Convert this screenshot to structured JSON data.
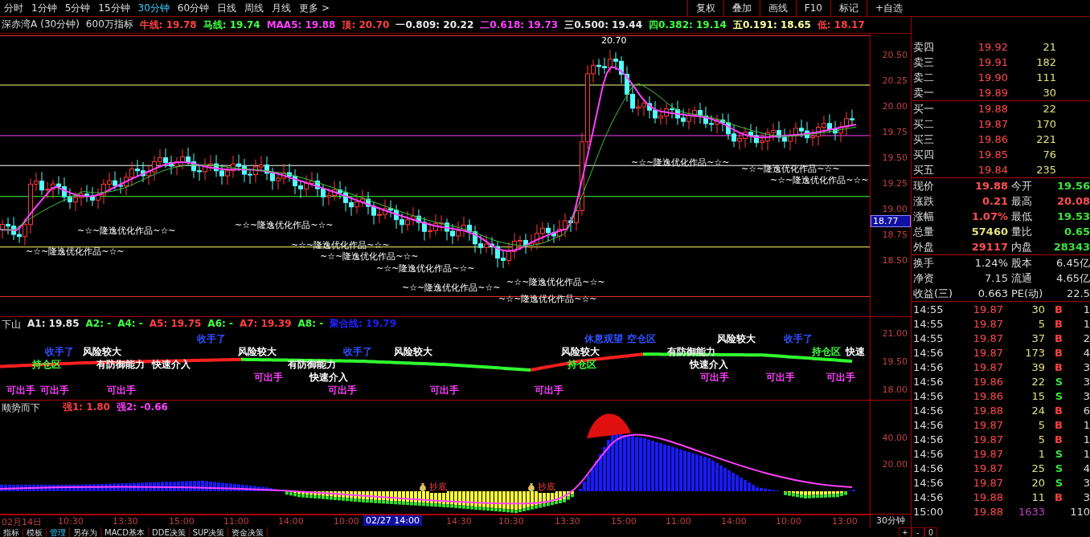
{
  "period_tabs": [
    {
      "label": "分时",
      "selected": false
    },
    {
      "label": "1分钟",
      "selected": false
    },
    {
      "label": "5分钟",
      "selected": false
    },
    {
      "label": "15分钟",
      "selected": false
    },
    {
      "label": "30分钟",
      "selected": true
    },
    {
      "label": "60分钟",
      "selected": false
    },
    {
      "label": "日线",
      "selected": false
    },
    {
      "label": "周线",
      "selected": false
    },
    {
      "label": "月线",
      "selected": false
    },
    {
      "label": "更多 >",
      "selected": false
    }
  ],
  "toolbar_buttons": [
    "复权",
    "叠加",
    "画线",
    "F10",
    "标记",
    "+自选"
  ],
  "info_bar": {
    "stock": "深赤湾A",
    "period": "(30分钟)",
    "indicator": "600万指标",
    "items": [
      {
        "text": "牛线: 19.78",
        "color": "#ff4040"
      },
      {
        "text": "马线: 19.74",
        "color": "#40ff40"
      },
      {
        "text": "MAA5: 19.88",
        "color": "#ff40ff"
      },
      {
        "text": "顶: 20.70",
        "color": "#ff4040"
      },
      {
        "text": "一0.809: 20.22",
        "color": "#e8e8e8"
      },
      {
        "text": "二0.618: 19.73",
        "color": "#ff40ff"
      },
      {
        "text": "三0.500: 19.44",
        "color": "#e8e8e8"
      },
      {
        "text": "四0.382: 19.14",
        "color": "#40ff40"
      },
      {
        "text": "五0.191: 18.65",
        "color": "#ffffa0"
      },
      {
        "text": "低: 18.17",
        "color": "#ff4040"
      }
    ]
  },
  "main_chart": {
    "top_label": "20.70",
    "current_price_tag": "18.77",
    "price_axis": [
      "20.50",
      "20.25",
      "20.00",
      "19.75",
      "19.50",
      "19.25",
      "19.00",
      "18.75",
      "18.50"
    ],
    "annotations": [
      "~☆~隆逸优化作品~☆~",
      "~☆~隆逸优化作品~☆~",
      "~☆~隆逸优化作品~☆~",
      "~☆~隆逸优化作品~☆~",
      "~☆~隆逸优化作品~☆~",
      "~☆~隆逸优化作品~☆~",
      "~☆~隆逸优化作品~☆~",
      "~☆~隆逸优化作品~☆~",
      "~☆~隆逸优化作品~☆~",
      "~☆~隆逸优化作品~☆~",
      "~☆~隆逸优化作品~☆~",
      "~☆~隆逸优化作品~☆~"
    ]
  },
  "indicator_panel": {
    "title": "下山",
    "values": [
      {
        "text": "A1: 19.85",
        "color": "#e8e8e8"
      },
      {
        "text": "A2: -",
        "color": "#40ff40"
      },
      {
        "text": "A4: -",
        "color": "#40ff40"
      },
      {
        "text": "A5: 19.75",
        "color": "#ff4040"
      },
      {
        "text": "A6: -",
        "color": "#40ff40"
      },
      {
        "text": "A7: 19.39",
        "color": "#ff4040"
      },
      {
        "text": "A8: -",
        "color": "#40ff40"
      },
      {
        "text": "聚合线: 19.79",
        "color": "#2020ff"
      }
    ],
    "axis": [
      "21.00",
      "19.50",
      "18.00"
    ],
    "signals": [
      {
        "text": "可出手",
        "color": "#ff40ff"
      },
      {
        "text": "持仓区",
        "color": "#40ff40"
      },
      {
        "text": "可出手",
        "color": "#ff40ff"
      },
      {
        "text": "收手了",
        "color": "#3050ff"
      },
      {
        "text": "风险较大",
        "color": "#ffffff"
      },
      {
        "text": "有防御能力",
        "color": "#ffffff"
      },
      {
        "text": "可出手",
        "color": "#ff40ff"
      },
      {
        "text": "快速介入",
        "color": "#ffffff"
      },
      {
        "text": "收手了",
        "color": "#3050ff"
      },
      {
        "text": "风险较大",
        "color": "#ffffff"
      },
      {
        "text": "可出手",
        "color": "#ff40ff"
      },
      {
        "text": "有防御能力",
        "color": "#ffffff"
      },
      {
        "text": "快速介入",
        "color": "#ffffff"
      },
      {
        "text": "可出手",
        "color": "#ff40ff"
      },
      {
        "text": "收手了",
        "color": "#3050ff"
      },
      {
        "text": "风险较大",
        "color": "#ffffff"
      },
      {
        "text": "可出手",
        "color": "#ff40ff"
      },
      {
        "text": "可出手",
        "color": "#ff40ff"
      },
      {
        "text": "风险较大",
        "color": "#ffffff"
      },
      {
        "text": "持仓区",
        "color": "#40ff40"
      },
      {
        "text": "休息观望",
        "color": "#3050ff"
      },
      {
        "text": "空仓区",
        "color": "#3050ff"
      },
      {
        "text": "有防御能力",
        "color": "#ffffff"
      },
      {
        "text": "快速介入",
        "color": "#ffffff"
      },
      {
        "text": "可出手",
        "color": "#ff40ff"
      },
      {
        "text": "风险较大",
        "color": "#ffffff"
      },
      {
        "text": "可出手",
        "color": "#ff40ff"
      },
      {
        "text": "收手了",
        "color": "#3050ff"
      },
      {
        "text": "持仓区",
        "color": "#40ff40"
      },
      {
        "text": "可出手",
        "color": "#ff40ff"
      },
      {
        "text": "快速",
        "color": "#ffffff"
      }
    ]
  },
  "trend_panel": {
    "title": "顺势而下",
    "values": [
      {
        "text": "强1: 1.80",
        "color": "#ff4040"
      },
      {
        "text": "强2: -0.66",
        "color": "#ff40ff"
      }
    ],
    "axis": [
      "40.00",
      "20.00"
    ],
    "signals": [
      "抄底",
      "抄底"
    ]
  },
  "time_axis": {
    "ticks": [
      "02月14日",
      "10:30",
      "13:30",
      "15:00",
      "11:00",
      "14:00",
      "10:00",
      "14:30",
      "10:30",
      "13:30",
      "15:00",
      "11:00",
      "14:00",
      "10:00",
      "13:00"
    ],
    "cursor": "02/27 14:00",
    "period": "30分钟",
    "zoom_buttons": [
      "+",
      "-",
      "0"
    ]
  },
  "bottom_tabs": [
    {
      "label": "指标",
      "selected": false
    },
    {
      "label": "模板",
      "selected": false
    },
    {
      "label": "管理",
      "selected": true
    },
    {
      "label": "另存为",
      "selected": false
    },
    {
      "label": "MACD基本",
      "selected": false
    },
    {
      "label": "DDE决策",
      "selected": false
    },
    {
      "label": "SUP决策",
      "selected": false
    },
    {
      "label": "资金决策",
      "selected": false
    }
  ],
  "order_book": {
    "asks": [
      {
        "label": "卖四",
        "price": "19.92",
        "volume": "21"
      },
      {
        "label": "卖三",
        "price": "19.91",
        "volume": "182"
      },
      {
        "label": "卖二",
        "price": "19.90",
        "volume": "111"
      },
      {
        "label": "卖一",
        "price": "19.89",
        "volume": "30"
      }
    ],
    "bids": [
      {
        "label": "买一",
        "price": "19.88",
        "volume": "22"
      },
      {
        "label": "买二",
        "price": "19.87",
        "volume": "170"
      },
      {
        "label": "买三",
        "price": "19.86",
        "volume": "221"
      },
      {
        "label": "买四",
        "price": "19.85",
        "volume": "76"
      },
      {
        "label": "买五",
        "price": "19.84",
        "volume": "235"
      }
    ]
  },
  "quote_stats": [
    {
      "label": "现价",
      "value": "19.88",
      "color": "#ff5050"
    },
    {
      "label": "今开",
      "value": "19.56",
      "color": "#40e040"
    },
    {
      "label": "涨跌",
      "value": "0.21",
      "color": "#ff5050"
    },
    {
      "label": "最高",
      "value": "20.08",
      "color": "#ff5050"
    },
    {
      "label": "涨幅",
      "value": "1.07%",
      "color": "#ff5050"
    },
    {
      "label": "最低",
      "value": "19.53",
      "color": "#40e040"
    },
    {
      "label": "总量",
      "value": "57460",
      "color": "#e0e080"
    },
    {
      "label": "量比",
      "value": "0.65",
      "color": "#40e040"
    },
    {
      "label": "外盘",
      "value": "29117",
      "color": "#ff5050"
    },
    {
      "label": "内盘",
      "value": "28343",
      "color": "#40e040"
    }
  ],
  "fundamentals": [
    {
      "label": "换手",
      "value": "1.24%",
      "label_2": "股本",
      "value_2": "6.45亿"
    },
    {
      "label": "净资",
      "value": "7.15",
      "label_2": "流通",
      "value_2": "4.65亿"
    },
    {
      "label": "收益(三)",
      "value": "0.663",
      "label_2": "PE(动)",
      "value_2": "22.5"
    }
  ],
  "trades": [
    {
      "time": "14:55",
      "price": "19.87",
      "volume": "30",
      "side": "B",
      "color": "#ff4040",
      "count": "1"
    },
    {
      "time": "14:55",
      "price": "19.87",
      "volume": "5",
      "side": "B",
      "color": "#ff4040",
      "count": "1"
    },
    {
      "time": "14:55",
      "price": "19.87",
      "volume": "37",
      "side": "B",
      "color": "#ff4040",
      "count": "2"
    },
    {
      "time": "14:56",
      "price": "19.87",
      "volume": "173",
      "side": "B",
      "color": "#ff4040",
      "count": "4"
    },
    {
      "time": "14:56",
      "price": "19.87",
      "volume": "39",
      "side": "B",
      "color": "#ff4040",
      "count": "3"
    },
    {
      "time": "14:56",
      "price": "19.86",
      "volume": "22",
      "side": "S",
      "color": "#40e040",
      "count": "3"
    },
    {
      "time": "14:56",
      "price": "19.86",
      "volume": "15",
      "side": "S",
      "color": "#40e040",
      "count": "3"
    },
    {
      "time": "14:56",
      "price": "19.88",
      "volume": "24",
      "side": "B",
      "color": "#ff4040",
      "count": "6"
    },
    {
      "time": "14:56",
      "price": "19.87",
      "volume": "5",
      "side": "B",
      "color": "#ff4040",
      "count": "1"
    },
    {
      "time": "14:56",
      "price": "19.87",
      "volume": "5",
      "side": "B",
      "color": "#ff4040",
      "count": "1"
    },
    {
      "time": "14:56",
      "price": "19.87",
      "volume": "1",
      "side": "S",
      "color": "#40e040",
      "count": "1"
    },
    {
      "time": "14:56",
      "price": "19.87",
      "volume": "25",
      "side": "S",
      "color": "#40e040",
      "count": "4"
    },
    {
      "time": "14:56",
      "price": "19.87",
      "volume": "20",
      "side": "S",
      "color": "#40e040",
      "count": "3"
    },
    {
      "time": "14:56",
      "price": "19.88",
      "volume": "11",
      "side": "B",
      "color": "#ff4040",
      "count": "3"
    },
    {
      "time": "15:00",
      "price": "19.88",
      "volume": "1633",
      "count": "110"
    }
  ]
}
